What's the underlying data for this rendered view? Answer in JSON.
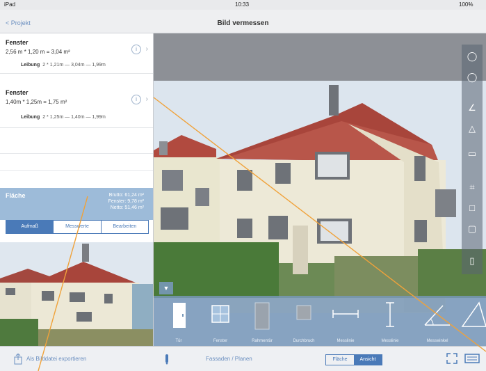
{
  "status": {
    "carrier": "iPad",
    "time": "10:33",
    "battery": "100%"
  },
  "nav": {
    "back": "< Projekt",
    "title": "Bild vermessen"
  },
  "measurements": [
    {
      "title": "Fenster",
      "calc": "2,56 m * 1,20 m = 3,04 m²",
      "opening_label": "Leibung",
      "opening_value": "2 * 1,21m — 3,04m — 1,99m"
    },
    {
      "title": "Fenster",
      "calc": "1,40m * 1,25m = 1,75 m²",
      "opening_label": "Leibung",
      "opening_value": "2 * 1,25m — 1,40m — 1,99m"
    }
  ],
  "area": {
    "title": "Fläche",
    "brutto": "Brutto:  61,24 m²",
    "fenster": "Fenster:  9,78 m²",
    "netto": "Netto:  51,46 m²"
  },
  "segments": [
    "Aufmaß",
    "Messwerte",
    "Bearbeiten"
  ],
  "picker": [
    {
      "label": "Tür",
      "icon": "door-icon"
    },
    {
      "label": "Fenster",
      "icon": "window-icon"
    },
    {
      "label": "Rahmentür",
      "icon": "frame-door-icon"
    },
    {
      "label": "Durchbruch",
      "icon": "opening-icon"
    },
    {
      "label": "Messlinie",
      "icon": "horizontal-line-icon"
    },
    {
      "label": "Messlinie",
      "icon": "vertical-line-icon"
    },
    {
      "label": "Messwinkel",
      "icon": "angle-icon"
    }
  ],
  "bottom": {
    "export": "Als Bilddatei exportieren",
    "plan": "Fassaden / Planen",
    "toggle": [
      "Fläche",
      "Ansicht"
    ]
  }
}
